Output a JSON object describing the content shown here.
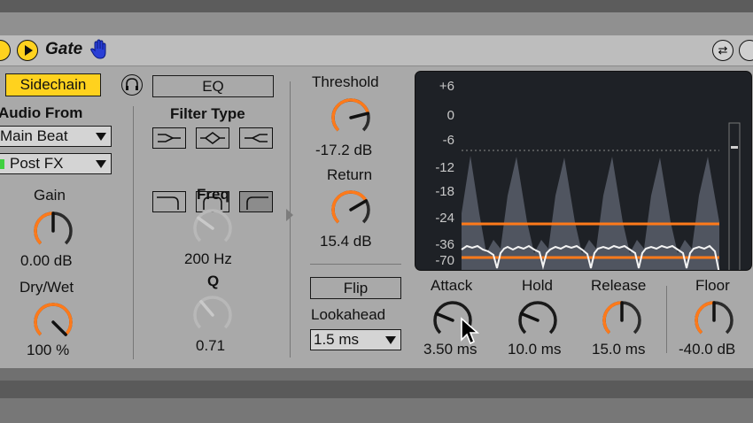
{
  "device": {
    "title": "Gate"
  },
  "sidechain": {
    "button_label": "Sidechain",
    "audio_from_label": "Audio From",
    "source_value": "Main Beat",
    "position_value": "Post FX",
    "gain_label": "Gain",
    "gain_value": "0.00 dB",
    "gain_level": 0.5,
    "drywet_label": "Dry/Wet",
    "drywet_value": "100 %",
    "drywet_level": 1.0
  },
  "eq": {
    "button_label": "EQ",
    "filter_type_label": "Filter Type",
    "filter_types": [
      "low-pass-icon",
      "band-pass-icon",
      "high-pass-icon",
      "low-shelf-icon",
      "peak-icon",
      "high-shelf-icon"
    ],
    "freq_label": "Freq",
    "freq_value": "200 Hz",
    "freq_level": 0.3,
    "q_label": "Q",
    "q_value": "0.71",
    "q_level": 0.35
  },
  "threshold": {
    "label": "Threshold",
    "value": "-17.2 dB",
    "level": 0.78,
    "return_label": "Return",
    "return_value": "15.4 dB",
    "return_level": 0.72
  },
  "flip": {
    "button_label": "Flip",
    "lookahead_label": "Lookahead",
    "lookahead_value": "1.5 ms"
  },
  "display": {
    "db_labels": [
      "+6",
      "0",
      "-6",
      "-12",
      "-18",
      "-24",
      "-36",
      "-70"
    ],
    "threshold_db": -18,
    "return_db": -33.4
  },
  "envelope": {
    "attack_label": "Attack",
    "attack_value": "3.50 ms",
    "attack_level": 0.25,
    "hold_label": "Hold",
    "hold_value": "10.0 ms",
    "hold_level": 0.25,
    "release_label": "Release",
    "release_value": "15.0 ms",
    "release_level": 0.5,
    "floor_label": "Floor",
    "floor_value": "-40.0 dB",
    "floor_level": 0.5
  },
  "colors": {
    "accent": "#ff7a1a",
    "button_on": "#ffd21e",
    "display_bg": "#1e2126"
  }
}
